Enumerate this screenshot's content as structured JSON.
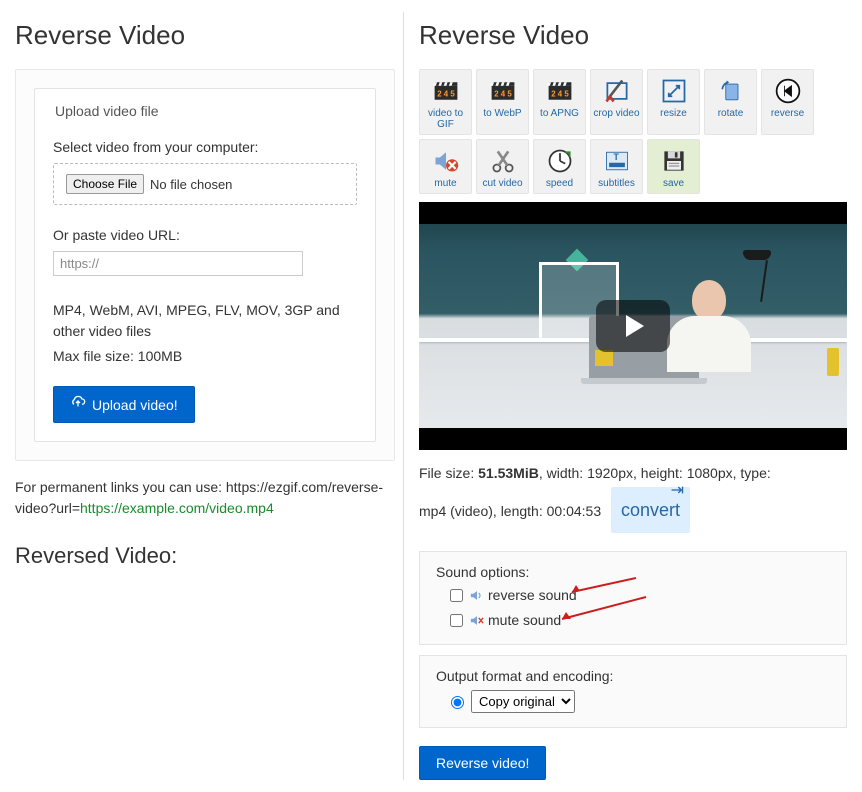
{
  "left": {
    "title": "Reverse Video",
    "legend": "Upload video file",
    "select_label": "Select video from your computer:",
    "choose_btn": "Choose File",
    "no_file": "No file chosen",
    "or_label": "Or paste video URL:",
    "url_placeholder": "https://",
    "supported": "MP4, WebM, AVI, MPEG, FLV, MOV, 3GP and other video files",
    "maxsize": "Max file size: 100MB",
    "upload_btn": "Upload video!",
    "permalink_pre": "For permanent links you can use: https://ezgif.com/reverse-video?url=",
    "permalink_link": "https://example.com/video.mp4",
    "result_heading": "Reversed Video:"
  },
  "right": {
    "title": "Reverse Video",
    "tools": [
      {
        "id": "video-to-gif",
        "label": "video to GIF"
      },
      {
        "id": "to-webp",
        "label": "to WebP"
      },
      {
        "id": "to-apng",
        "label": "to APNG"
      },
      {
        "id": "crop-video",
        "label": "crop video"
      },
      {
        "id": "resize",
        "label": "resize"
      },
      {
        "id": "rotate",
        "label": "rotate"
      },
      {
        "id": "reverse",
        "label": "reverse"
      },
      {
        "id": "mute",
        "label": "mute"
      },
      {
        "id": "cut-video",
        "label": "cut video"
      },
      {
        "id": "speed",
        "label": "speed"
      },
      {
        "id": "subtitles",
        "label": "subtitles"
      },
      {
        "id": "save",
        "label": "save"
      }
    ],
    "meta": {
      "pre_size": "File size: ",
      "size": "51.53MiB",
      "post_size": ", width: 1920px, height: 1080px, type:",
      "line2_pre": "mp4 (video), length: 00:04:53",
      "convert": "convert"
    },
    "sound_heading": "Sound options:",
    "reverse_sound": "reverse sound",
    "mute_sound": "mute sound",
    "output_heading": "Output format and encoding:",
    "output_option": "Copy original",
    "submit": "Reverse video!"
  }
}
